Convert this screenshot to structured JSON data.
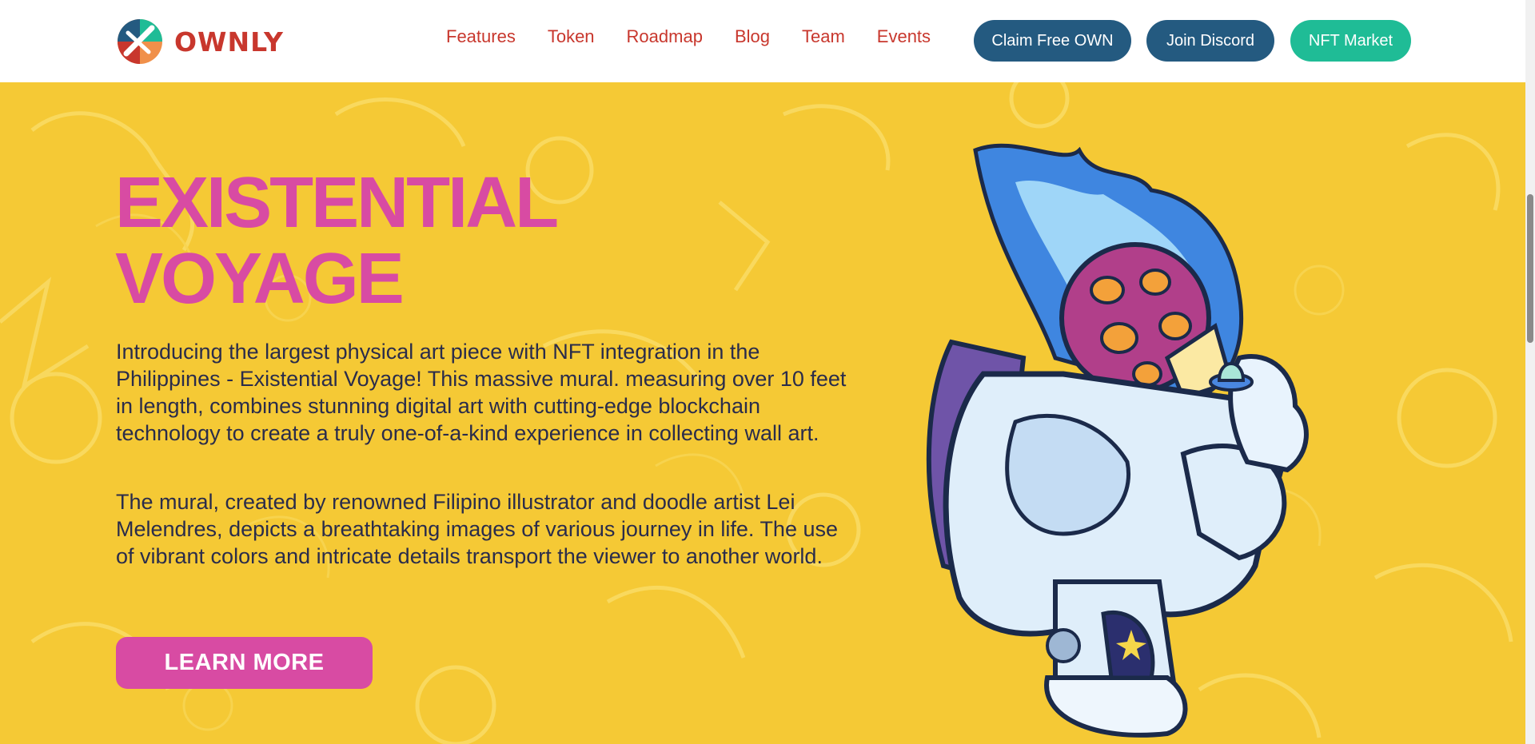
{
  "brand": {
    "name": "OWNLY",
    "logo_icon": "ownly-logo-icon"
  },
  "nav": {
    "items": [
      "Features",
      "Token",
      "Roadmap",
      "Blog",
      "Team",
      "Events"
    ]
  },
  "actions": {
    "claim": "Claim Free OWN",
    "discord": "Join Discord",
    "nft": "NFT Market"
  },
  "hero": {
    "title_line1": "EXISTENTIAL",
    "title_line2": "VOYAGE",
    "paragraph1": "Introducing the largest physical art piece with NFT integration in the Philippines - Existential Voyage! This massive mural. measuring over 10 feet in length, combines stunning digital art with cutting-edge blockchain technology to create a truly one-of-a-kind experience in collecting wall art.",
    "paragraph2": "The mural, created by renowned Filipino illustrator and doodle artist Lei Melendres, depicts a breathtaking images of various journey in life. The use of vibrant colors and intricate details transport the viewer to another world.",
    "cta": "LEARN MORE",
    "illustration": "astronaut-illustration"
  },
  "colors": {
    "brand_red": "#c8372d",
    "navy": "#245a80",
    "teal": "#1fbc96",
    "pink": "#d84ba3",
    "hero_yellow": "#f5c935",
    "text_dark": "#2a2c4b"
  }
}
